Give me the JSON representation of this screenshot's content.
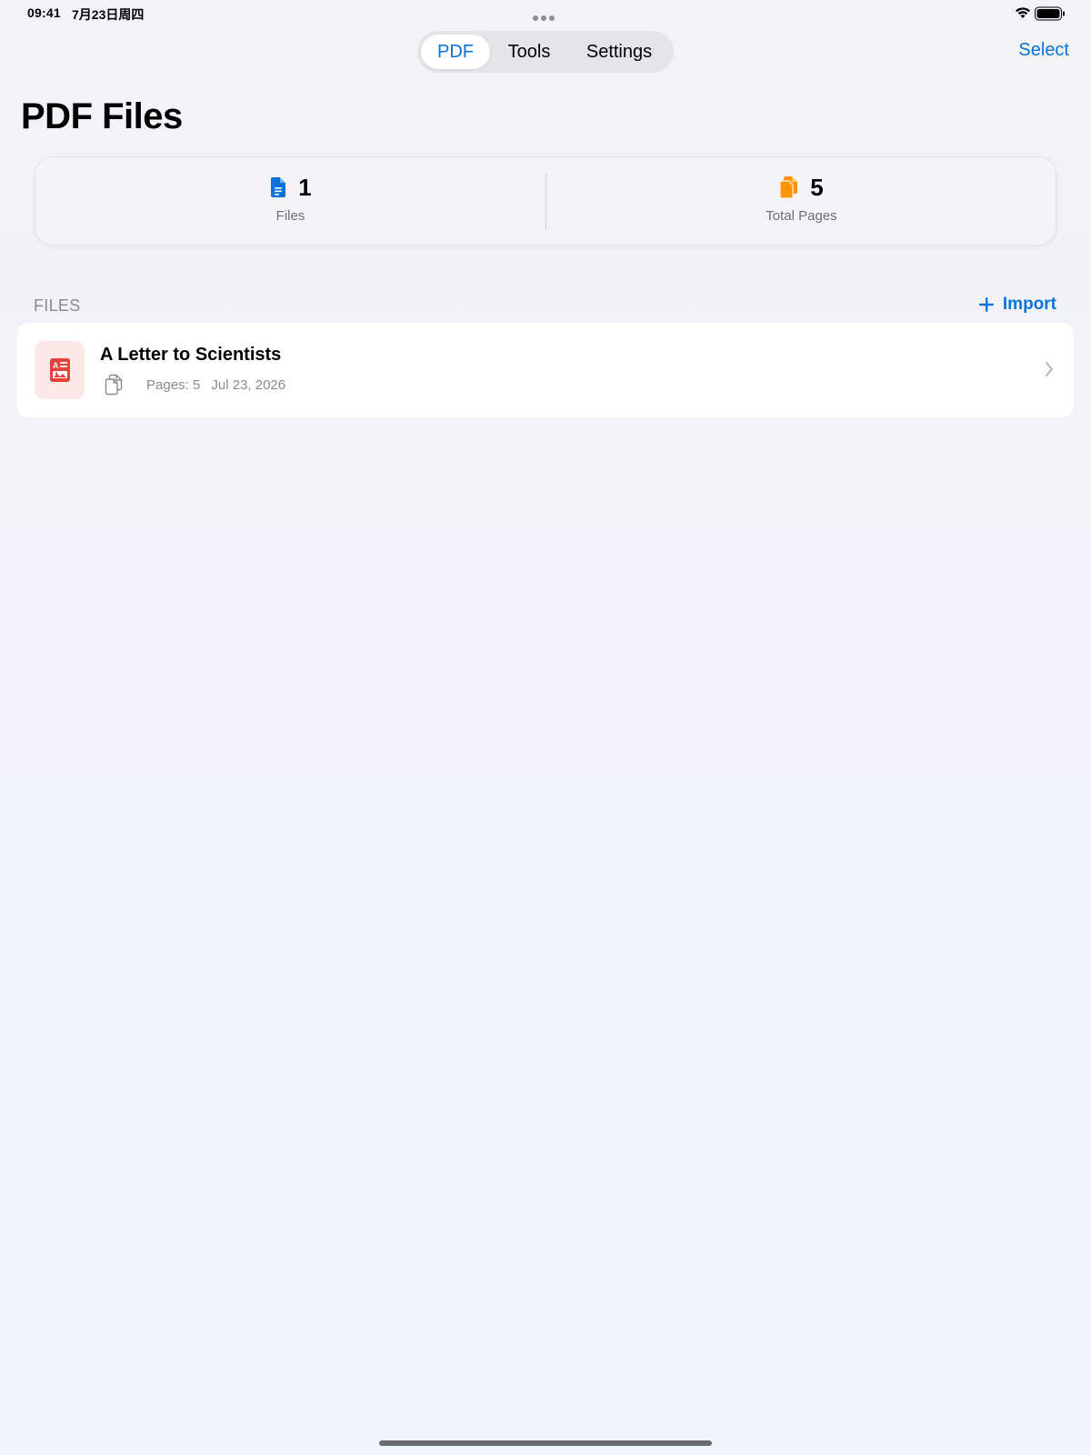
{
  "status_bar": {
    "time": "09:41",
    "date": "7月23日周四",
    "wifi_icon": "wifi-icon",
    "battery_icon": "battery-full-icon"
  },
  "tabs": [
    {
      "label": "PDF",
      "active": true
    },
    {
      "label": "Tools",
      "active": false
    },
    {
      "label": "Settings",
      "active": false
    }
  ],
  "header": {
    "select_label": "Select",
    "title": "PDF Files"
  },
  "stats": {
    "files": {
      "value": "1",
      "label": "Files",
      "icon": "document-icon",
      "color": "#0a72d9"
    },
    "pages": {
      "value": "5",
      "label": "Total Pages",
      "icon": "pages-icon",
      "color": "#ff9500"
    }
  },
  "files_section": {
    "header": "FILES",
    "import_label": "Import",
    "items": [
      {
        "name": "A Letter to Scientists",
        "pages": "Pages: 5",
        "date": "Jul 23, 2026",
        "thumb_icon": "pdf-document-icon"
      }
    ]
  },
  "colors": {
    "accent": "#0a72d9",
    "pages_accent": "#ff9500",
    "pdf_red": "#e8413c"
  }
}
